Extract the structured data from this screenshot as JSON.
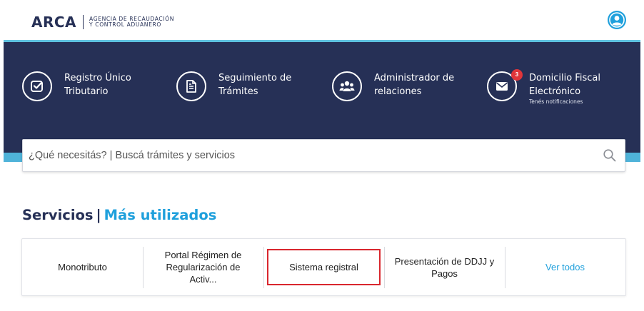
{
  "header": {
    "logo": "ARCA",
    "agency_line1": "AGENCIA DE RECAUDACIÓN",
    "agency_line2": "Y CONTROL ADUANERO"
  },
  "quick_access": [
    {
      "line1": "Registro Único",
      "line2": "Tributario",
      "icon": "checkbox-icon"
    },
    {
      "line1": "Seguimiento de",
      "line2": "Trámites",
      "icon": "document-icon"
    },
    {
      "line1": "Administrador de",
      "line2": "relaciones",
      "icon": "users-icon"
    },
    {
      "line1": "Domicilio Fiscal",
      "line2": "Electrónico",
      "note": "Tenés notificaciones",
      "badge": "3",
      "icon": "envelope-icon"
    }
  ],
  "search": {
    "placeholder": "¿Qué necesitás? | Buscá trámites y servicios"
  },
  "services": {
    "title": "Servicios",
    "separator": "|",
    "subtitle": "Más utilizados",
    "items": [
      "Monotributo",
      "Portal Régimen de Regularización de Activ...",
      "Sistema registral",
      "Presentación de DDJJ y Pagos"
    ],
    "see_all": "Ver todos"
  },
  "colors": {
    "navy": "#263056",
    "accent": "#1fa0dc",
    "band_border": "#5fc2e0",
    "badge": "#e0353a",
    "highlight": "#d9272e"
  }
}
